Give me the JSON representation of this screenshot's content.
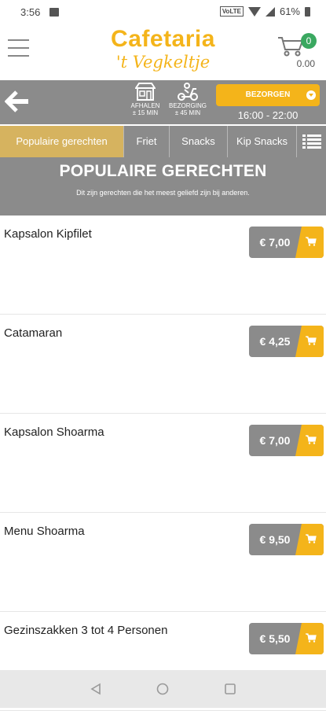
{
  "status": {
    "time": "3:56",
    "network": "VoLTE",
    "battery": "61%"
  },
  "header": {
    "logo_line1": "Cafetaria",
    "logo_line2": "'t Vegkeltje",
    "cart_count": "0",
    "cart_total": "0.00"
  },
  "delivery": {
    "afhalen_label": "AFHALEN",
    "afhalen_time": "± 15 MIN",
    "bezorging_label": "BEZORGING",
    "bezorging_time": "± 45 MIN",
    "mode_button": "BEZORGEN",
    "time_range": "16:00 - 22:00"
  },
  "tabs": [
    {
      "label": "Populaire gerechten",
      "active": true
    },
    {
      "label": "Friet"
    },
    {
      "label": "Snacks"
    },
    {
      "label": "Kip Snacks"
    }
  ],
  "section": {
    "title": "POPULAIRE GERECHTEN",
    "subtitle": "Dit zijn gerechten die het meest geliefd zijn bij anderen."
  },
  "items": [
    {
      "name": "Kapsalon Kipfilet",
      "price": "€ 7,00"
    },
    {
      "name": "Catamaran",
      "price": "€ 4,25"
    },
    {
      "name": "Kapsalon Shoarma",
      "price": "€ 7,00"
    },
    {
      "name": "Menu Shoarma",
      "price": "€ 9,50"
    },
    {
      "name": "Gezinszakken 3 tot 4 Personen",
      "price": "€ 5,50"
    }
  ],
  "colors": {
    "accent": "#f4b41a",
    "bar": "#8b8b8b",
    "active_tab": "#d6b35f",
    "badge": "#3aa860"
  }
}
